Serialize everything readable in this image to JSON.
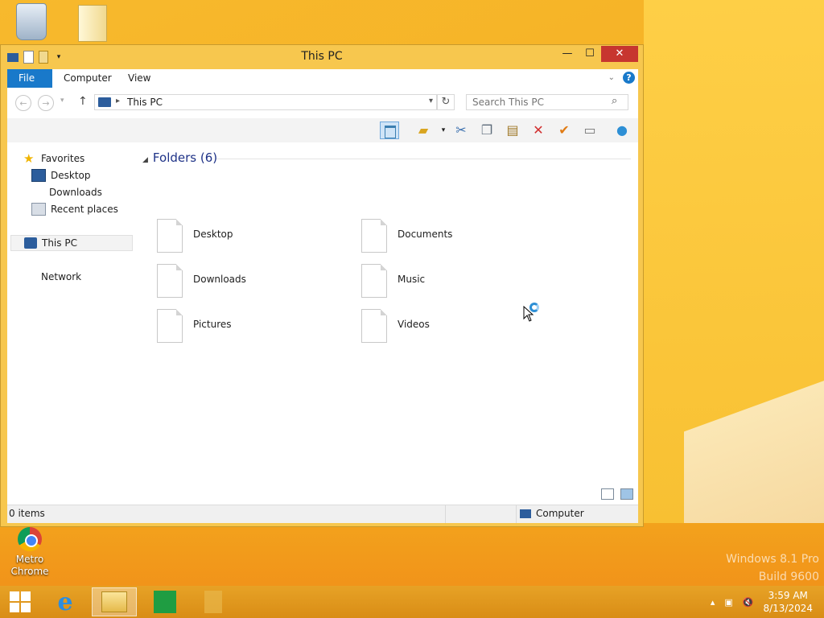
{
  "desktop": {
    "icons": [
      {
        "name": "Recycle Bin",
        "label": ""
      },
      {
        "name": "folder",
        "label": ""
      },
      {
        "name": "Metro Chrome",
        "label": "Metro Chrome"
      }
    ],
    "watermark_line1": "Windows 8.1 Pro",
    "watermark_line2": "Build 9600"
  },
  "window": {
    "title": "This PC",
    "quick_access": {
      "undo_icon": "properties-icon",
      "new_folder_icon": "new-folder-icon"
    },
    "controls": {
      "minimize": "—",
      "maximize": "☐",
      "close": "✕"
    },
    "ribbon_tabs": [
      {
        "label": "File"
      },
      {
        "label": "Computer"
      },
      {
        "label": "View"
      }
    ],
    "address": {
      "path": "This PC",
      "search_placeholder": "Search This PC"
    },
    "toolbar_icons": [
      "layout-icon",
      "folder-options-icon",
      "cut-icon",
      "copy-icon",
      "paste-icon",
      "delete-icon",
      "check-icon",
      "rename-icon",
      "globe-icon"
    ],
    "nav": {
      "favorites": "Favorites",
      "desktop": "Desktop",
      "downloads": "Downloads",
      "recent": "Recent places",
      "thispc": "This PC",
      "network": "Network"
    },
    "group_header": "Folders (6)",
    "folders": [
      {
        "label": "Desktop"
      },
      {
        "label": "Documents"
      },
      {
        "label": "Downloads"
      },
      {
        "label": "Music"
      },
      {
        "label": "Pictures"
      },
      {
        "label": "Videos"
      }
    ],
    "status": {
      "items": "0 items",
      "location": "Computer"
    }
  },
  "taskbar": {
    "pinned": [
      "start",
      "internet-explorer",
      "file-explorer",
      "store",
      "blank"
    ],
    "time": "3:59 AM",
    "date": "8/13/2024"
  },
  "colors": {
    "accent": "#1979ca",
    "close": "#c7362f",
    "desktop": "#f6b124"
  }
}
